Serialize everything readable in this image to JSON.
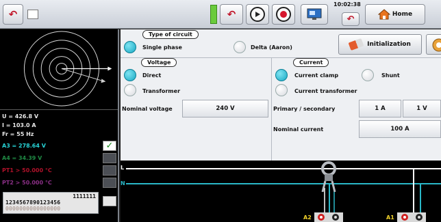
{
  "toolbar": {
    "clock": "10:02:38",
    "home_label": "Home"
  },
  "measurements": {
    "u": "U = 426.8 V",
    "i": "I = 103.0 A",
    "fr": "Fr = 55 Hz",
    "a3": "A3 = 278.64 V",
    "a4": "A4 = 34.39 V",
    "pt1": "PT1 > 50.000 °C",
    "pt2": "PT2 > 50.000 °C"
  },
  "digits": {
    "line1": "1111111",
    "line2": "1234567890123456",
    "line3": "0000000000000000"
  },
  "circuit": {
    "title": "Type of circuit",
    "single_phase": "Single phase",
    "delta": "Delta (Aaron)",
    "selected": "single_phase",
    "init_label": "Initialization"
  },
  "voltage": {
    "title": "Voltage",
    "direct": "Direct",
    "transformer": "Transformer",
    "selected": "direct",
    "nominal_label": "Nominal voltage",
    "nominal_value": "240 V"
  },
  "current": {
    "title": "Current",
    "clamp": "Current clamp",
    "shunt": "Shunt",
    "transformer": "Current transformer",
    "selected": "clamp",
    "primary_label": "Primary / secondary",
    "primary_value": "1 A",
    "secondary_value": "1 V",
    "nominal_label": "Nominal current",
    "nominal_value": "100 A"
  },
  "diagram": {
    "line_l": "L",
    "line_n": "N",
    "terminal_a2": "A2",
    "terminal_a1": "A1"
  },
  "colors": {
    "measure_white": "#e8e8e8",
    "a3": "#27d3d6",
    "a4": "#1f8a44",
    "pt1": "#b0122a",
    "pt2": "#8a2f86",
    "radio_on": "#19a9c4"
  }
}
